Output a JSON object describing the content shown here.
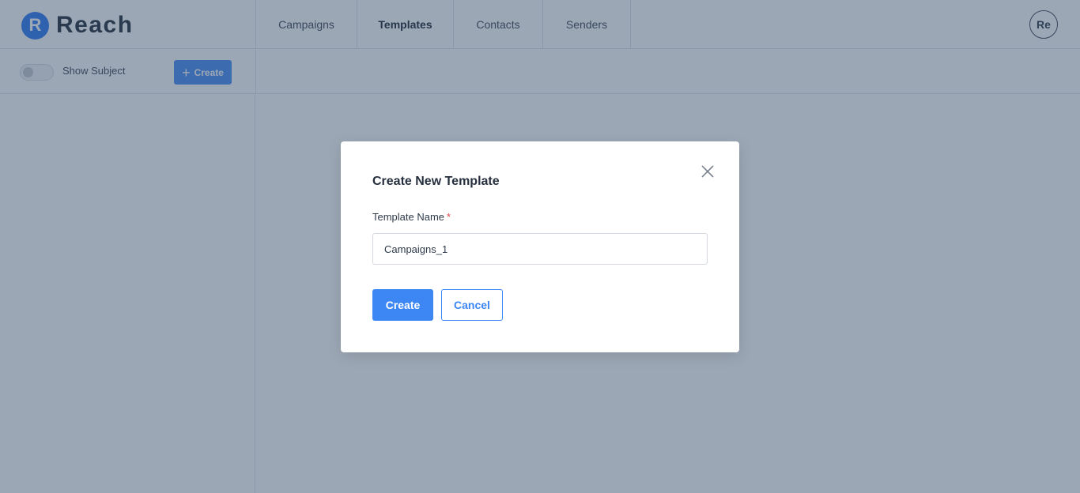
{
  "app": {
    "logo_letter": "R",
    "logo_text": "Reach",
    "brand_color": "#2f7bf2"
  },
  "nav": {
    "tabs": [
      {
        "label": "Campaigns",
        "active": false
      },
      {
        "label": "Templates",
        "active": true
      },
      {
        "label": "Contacts",
        "active": false
      },
      {
        "label": "Senders",
        "active": false
      }
    ]
  },
  "user": {
    "avatar_initials": "Re"
  },
  "toolbar": {
    "toggle_label": "Show Subject",
    "toggle_on": false,
    "create_label": "Create",
    "create_icon": "plus-icon"
  },
  "modal": {
    "title": "Create New Template",
    "close_icon": "close-icon",
    "field_label": "Template Name",
    "required_marker": "*",
    "field_value": "Campaigns_1",
    "create_label": "Create",
    "cancel_label": "Cancel",
    "accent_color": "#3d87f5"
  }
}
